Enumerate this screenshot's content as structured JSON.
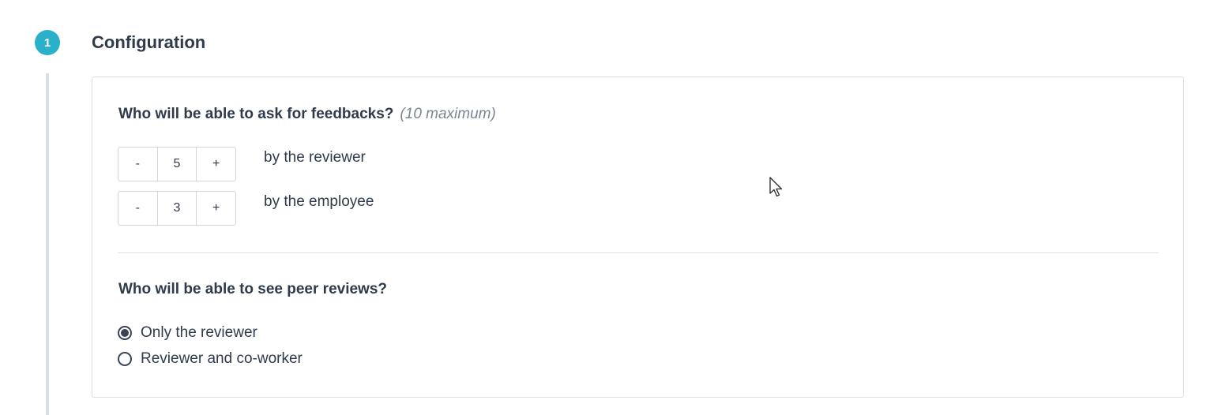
{
  "step": {
    "number": "1",
    "title": "Configuration"
  },
  "feedback_section": {
    "question": "Who will be able to ask for feedbacks?",
    "hint": "(10 maximum)",
    "steppers": [
      {
        "decrement_label": "-",
        "value": "5",
        "increment_label": "+",
        "label": "by the reviewer"
      },
      {
        "decrement_label": "-",
        "value": "3",
        "increment_label": "+",
        "label": "by the employee"
      }
    ]
  },
  "peer_section": {
    "question": "Who will be able to see peer reviews?",
    "options": [
      {
        "label": "Only the reviewer",
        "selected": true
      },
      {
        "label": "Reviewer and co-worker",
        "selected": false
      }
    ]
  },
  "colors": {
    "accent": "#2bb0cc",
    "text": "#2f3a4b",
    "border": "#d9dfe7"
  },
  "icons": {
    "cursor": "mouse-pointer-icon"
  }
}
